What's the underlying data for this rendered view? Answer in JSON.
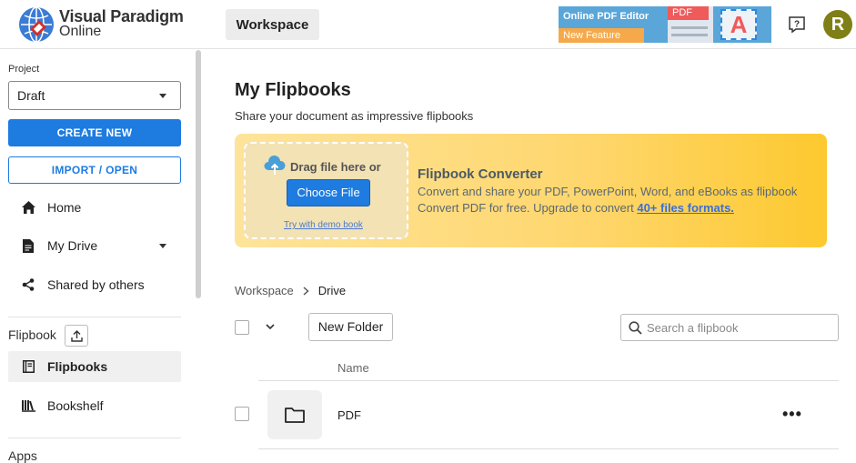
{
  "header": {
    "logo_line1": "Visual Paradigm",
    "logo_line2": "Online",
    "workspace_label": "Workspace",
    "banner": {
      "title": "Online PDF Editor",
      "tag": "New Feature",
      "pdf_label": "PDF",
      "letter": "A"
    },
    "help_icon": "help-question-icon",
    "avatar_letter": "R",
    "avatar_color": "#7f7f17"
  },
  "sidebar": {
    "project_label": "Project",
    "project_value": "Draft",
    "create_label": "CREATE NEW",
    "import_label": "IMPORT / OPEN",
    "nav": [
      {
        "label": "Home",
        "icon": "home-icon"
      },
      {
        "label": "My Drive",
        "icon": "document-icon"
      },
      {
        "label": "Shared by others",
        "icon": "share-icon"
      }
    ],
    "section_label": "Flipbook",
    "flipbook_nav": [
      {
        "label": "Flipbooks",
        "icon": "flipbook-icon",
        "active": true
      },
      {
        "label": "Bookshelf",
        "icon": "bookshelf-icon"
      }
    ],
    "apps_label": "Apps"
  },
  "main": {
    "title": "My Flipbooks",
    "subtitle": "Share your document as impressive flipbooks",
    "hero": {
      "drag_text": "Drag file here or",
      "choose_label": "Choose File",
      "demo_link": "Try with demo book",
      "title": "Flipbook Converter",
      "line1": "Convert and share your PDF, PowerPoint, Word, and eBooks as flipbook",
      "line2": "Convert PDF for free. Upgrade to convert",
      "line2_link": "40+ files formats."
    },
    "breadcrumb": [
      "Workspace",
      "Drive"
    ],
    "new_folder_label": "New Folder",
    "search_placeholder": "Search a flipbook",
    "column_name": "Name",
    "rows": [
      {
        "name": "PDF",
        "icon": "folder-icon",
        "menu": "•••"
      }
    ]
  },
  "colors": {
    "primary": "#1e7be0",
    "hero_start": "#fde49b",
    "hero_end": "#fdc92f"
  }
}
